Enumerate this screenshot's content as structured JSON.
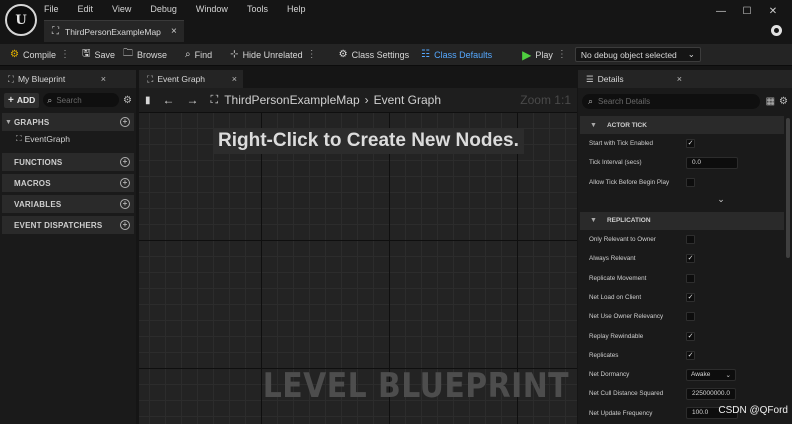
{
  "menu": [
    "File",
    "Edit",
    "View",
    "Debug",
    "Window",
    "Tools",
    "Help"
  ],
  "document_tab": {
    "label": "ThirdPersonExampleMap",
    "close": "×"
  },
  "window_controls": {
    "minimize": "—",
    "maximize": "☐",
    "close": "✕"
  },
  "toolbar": {
    "compile": "Compile",
    "save": "Save",
    "browse": "Browse",
    "find": "Find",
    "hide_unrelated": "Hide Unrelated",
    "class_settings": "Class Settings",
    "class_defaults": "Class Defaults",
    "play": "Play",
    "debug_select": "No debug object selected"
  },
  "left_panel": {
    "tab_label": "My Blueprint",
    "add_label": "ADD",
    "search_placeholder": "Search",
    "sections": {
      "graphs": "GRAPHS",
      "functions": "FUNCTIONS",
      "macros": "MACROS",
      "variables": "VARIABLES",
      "event_dispatchers": "EVENT DISPATCHERS"
    },
    "graph_items": [
      "EventGraph"
    ]
  },
  "center": {
    "tab_label": "Event Graph",
    "breadcrumb": [
      "ThirdPersonExampleMap",
      "Event Graph"
    ],
    "breadcrumb_sep": "›",
    "zoom": "Zoom 1:1",
    "hint": "Right-Click to Create New Nodes.",
    "watermark": "LEVEL BLUEPRINT"
  },
  "details": {
    "tab_label": "Details",
    "search_placeholder": "Search Details",
    "actor_tick": {
      "title": "ACTOR TICK",
      "start_with_tick_enabled": {
        "label": "Start with Tick Enabled",
        "checked": true
      },
      "tick_interval": {
        "label": "Tick Interval (secs)",
        "value": "0.0"
      },
      "allow_tick_before_begin_play": {
        "label": "Allow Tick Before Begin Play",
        "checked": false
      }
    },
    "replication": {
      "title": "REPLICATION",
      "only_relevant_to_owner": {
        "label": "Only Relevant to Owner",
        "checked": false
      },
      "always_relevant": {
        "label": "Always Relevant",
        "checked": true
      },
      "replicate_movement": {
        "label": "Replicate Movement",
        "checked": false
      },
      "net_load_on_client": {
        "label": "Net Load on Client",
        "checked": true
      },
      "net_use_owner_relevancy": {
        "label": "Net Use Owner Relevancy",
        "checked": false
      },
      "replay_rewindable": {
        "label": "Replay Rewindable",
        "checked": true
      },
      "replicates": {
        "label": "Replicates",
        "checked": true
      },
      "net_dormancy": {
        "label": "Net Dormancy",
        "value": "Awake"
      },
      "net_cull_distance_squared": {
        "label": "Net Cull Distance Squared",
        "value": "225000000.0"
      },
      "net_update_frequency": {
        "label": "Net Update Frequency",
        "value": "100.0"
      }
    }
  },
  "credit": "CSDN @QFord"
}
